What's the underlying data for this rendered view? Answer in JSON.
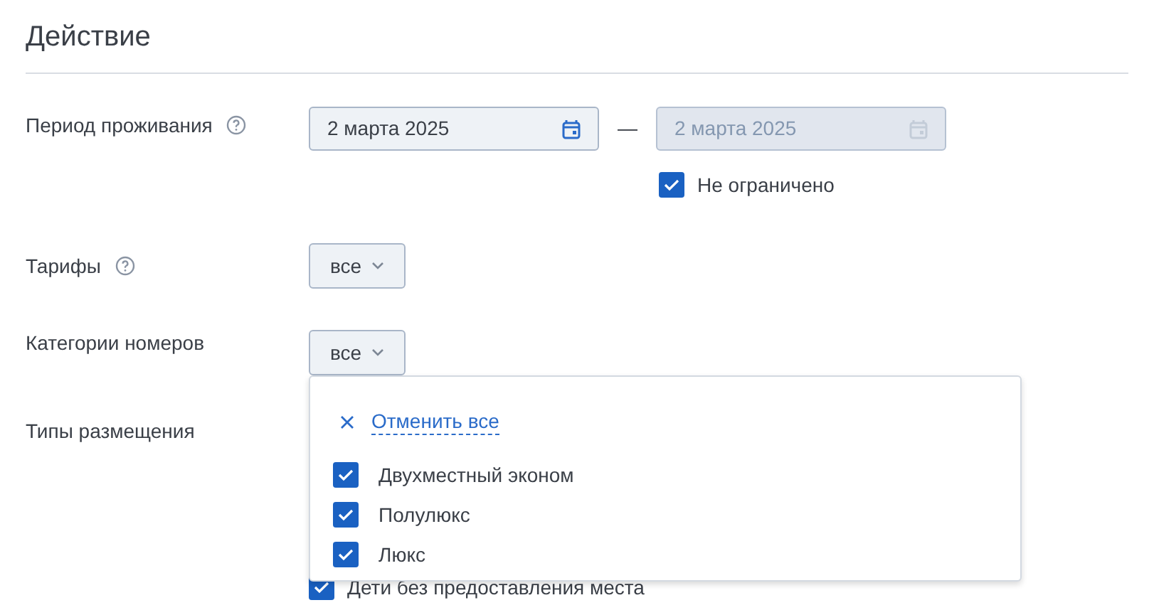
{
  "title": "Действие",
  "stay_period": {
    "label": "Период проживания",
    "start_date": "2 марта 2025",
    "separator": "—",
    "end_date": {
      "value": "2 марта 2025",
      "disabled": true
    },
    "unlimited": {
      "label": "Не ограничено",
      "checked": true
    }
  },
  "rates": {
    "label": "Тарифы",
    "value": "все"
  },
  "room_categories": {
    "label": "Категории номеров",
    "value": "все",
    "expanded": true,
    "dropdown": {
      "clear_label": "Отменить все",
      "options": [
        {
          "label": "Двухместный эконом",
          "checked": true
        },
        {
          "label": "Полулюкс",
          "checked": true
        },
        {
          "label": "Люкс",
          "checked": true
        }
      ]
    }
  },
  "accommodation_types": {
    "label": "Типы размещения",
    "options": [
      {
        "label": "Дети без предоставления места",
        "checked": true
      }
    ]
  }
}
